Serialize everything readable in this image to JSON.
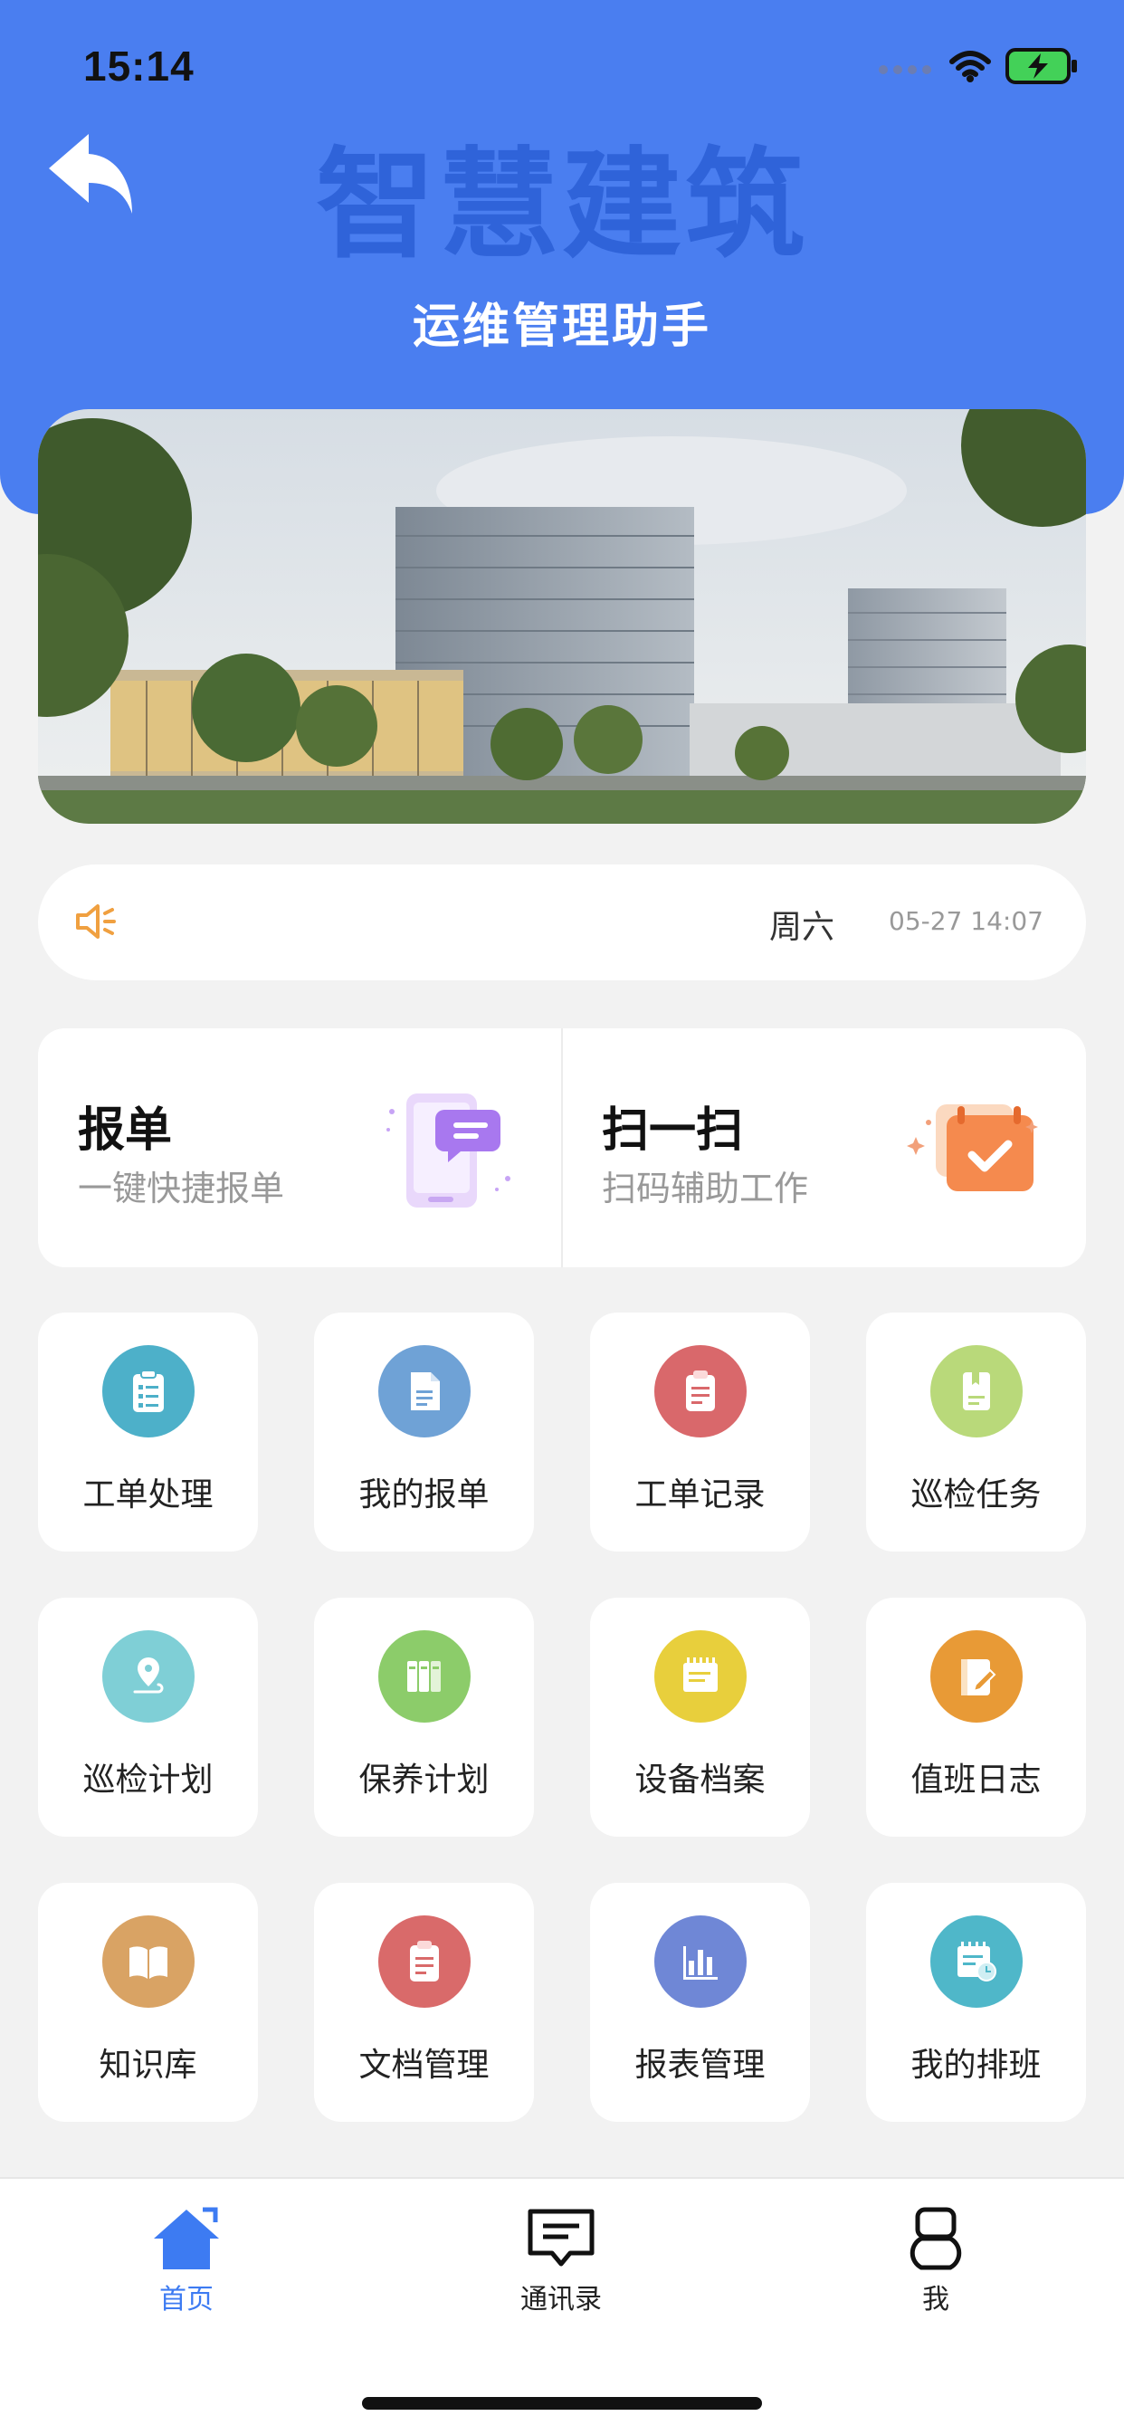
{
  "status_bar": {
    "time": "15:14"
  },
  "header": {
    "brand": "智慧建筑",
    "subtitle": "运维管理助手"
  },
  "notice": {
    "weekday": "周六",
    "datetime": "05-27 14:07"
  },
  "quick_actions": [
    {
      "title": "报单",
      "desc": "一键快捷报单"
    },
    {
      "title": "扫一扫",
      "desc": "扫码辅助工作"
    }
  ],
  "grid": [
    {
      "label": "工单处理",
      "color": "#4db0c9",
      "icon": "clipboard-list-icon"
    },
    {
      "label": "我的报单",
      "color": "#6fa2d6",
      "icon": "document-icon"
    },
    {
      "label": "工单记录",
      "color": "#d9686b",
      "icon": "clipboard-icon"
    },
    {
      "label": "巡检任务",
      "color": "#b9d97a",
      "icon": "book-icon"
    },
    {
      "label": "巡检计划",
      "color": "#7fcfd6",
      "icon": "location-pin-icon"
    },
    {
      "label": "保养计划",
      "color": "#8ccc6a",
      "icon": "binders-icon"
    },
    {
      "label": "设备档案",
      "color": "#e8cf3c",
      "icon": "notepad-icon"
    },
    {
      "label": "值班日志",
      "color": "#e89a36",
      "icon": "edit-log-icon"
    },
    {
      "label": "知识库",
      "color": "#d9a364",
      "icon": "open-book-icon"
    },
    {
      "label": "文档管理",
      "color": "#d96a6a",
      "icon": "clipboard-doc-icon"
    },
    {
      "label": "报表管理",
      "color": "#6f87d6",
      "icon": "bar-chart-icon"
    },
    {
      "label": "我的排班",
      "color": "#4fb7c9",
      "icon": "calendar-clock-icon"
    }
  ],
  "tabbar": [
    {
      "label": "首页",
      "icon": "home-icon",
      "active": true
    },
    {
      "label": "通讯录",
      "icon": "message-icon",
      "active": false
    },
    {
      "label": "我",
      "icon": "user-icon",
      "active": false
    }
  ],
  "colors": {
    "primary": "#4a7ef0",
    "brand_text": "#2f63d9",
    "active_tab": "#3d7bf2",
    "speaker": "#f0a040"
  }
}
